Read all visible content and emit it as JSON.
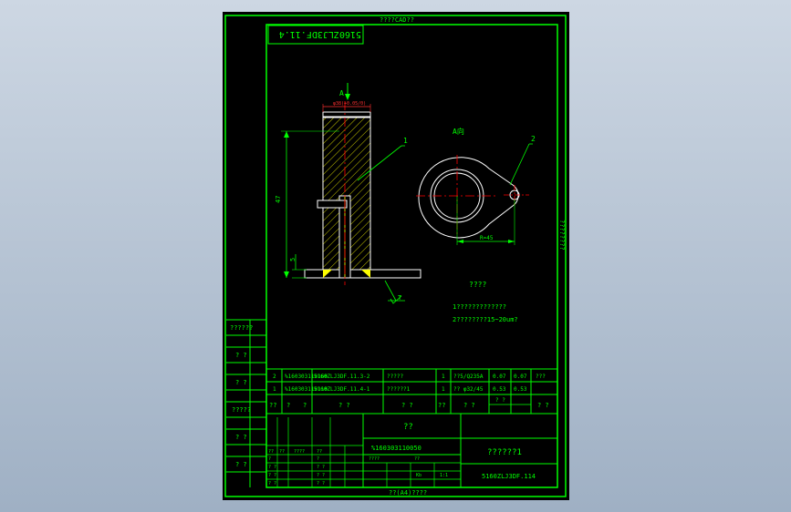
{
  "colors": {
    "frame": "#00ff00",
    "text": "#00ff00",
    "geometry": "#ffffff",
    "dimension": "#00ff00",
    "centerline": "#ff0000",
    "hatch": "#ffff00",
    "annotation_red": "#ff3030"
  },
  "sheet": {
    "top_label": "????CAD??",
    "bottom_label": "??(A4)????",
    "side_label": "????????",
    "code_box": "5160ZLJ3DF.11.4"
  },
  "views": {
    "section_label": "A",
    "section_top_dim": "φ38(+0.05/0)",
    "height_dim": "47",
    "flange_dim": "5",
    "leader_1": "1",
    "leader_2": "2",
    "view_label": "A向",
    "center_distance_dim": "R=45",
    "surface_symbol": "T"
  },
  "notes": {
    "title": "????",
    "line1": "1?????????????",
    "line2": "2????????15~20um?"
  },
  "left_column": [
    "??????",
    "? ?",
    "? ?",
    "?????",
    "? ?",
    "? ?"
  ],
  "bom": {
    "rows": [
      [
        "2",
        "%160303110160",
        "5160ZLJ3DF.11.3-2",
        "?????",
        "1",
        "??5/Q235A",
        "0.07",
        "0.07",
        "???"
      ],
      [
        "1",
        "%160303110110",
        "5160ZLJ3DF.11.4-1",
        "??????1",
        "1",
        "?? φ32/45",
        "0.53",
        "0.53",
        ""
      ]
    ],
    "header": [
      "??",
      "?",
      "?",
      "? ?",
      "? ?",
      "??",
      "? ?",
      "? ?",
      "? ?"
    ]
  },
  "title_block": {
    "part_name": "??",
    "part_number": "%160303110050",
    "assembly_name": "??????1",
    "drawing_code": "5160ZLJ3DF.114",
    "mini_headers": [
      "??",
      "??",
      "????",
      "??"
    ],
    "mini_rows": [
      [
        "?",
        "?"
      ],
      [
        "? ?",
        "? ?"
      ],
      [
        "? ?",
        "? ?"
      ],
      [
        "? ?",
        "? ?"
      ]
    ],
    "stage_labels": [
      "????",
      "??"
    ],
    "qty_label": "Kb",
    "scale_value": "1:1"
  }
}
